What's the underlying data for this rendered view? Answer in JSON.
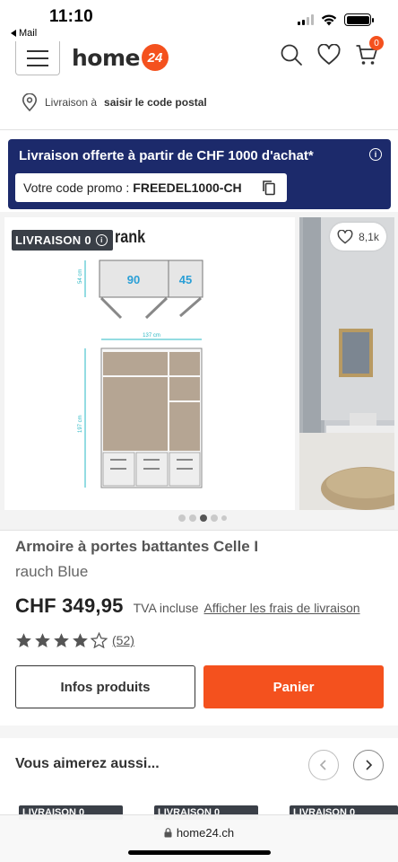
{
  "status": {
    "time": "11:10",
    "back_app": "Mail"
  },
  "header": {
    "logo_word": "home",
    "logo_badge": "24",
    "cart_count": "0"
  },
  "delivery": {
    "prefix": "Livraison à",
    "link": "saisir le code postal"
  },
  "promo": {
    "headline": "Livraison offerte à partir de CHF 1000 d'achat*",
    "code_label": "Votre code promo :",
    "code": "FREEDEL1000-CH",
    "info_glyph": "i"
  },
  "gallery": {
    "tag": "LIVRAISON 0",
    "brand_fragment": "rank",
    "wishlist_count": "8,1k",
    "dimensions": {
      "box1": "90",
      "box2": "45",
      "width": "137 cm",
      "upper_height": "54 cm",
      "lower_height": "197 cm"
    },
    "slide_count": 5,
    "active_slide": 3
  },
  "product": {
    "title": "Armoire à portes battantes Celle I",
    "brand": "rauch Blue",
    "price": "CHF 349,95",
    "tva": "TVA incluse",
    "shipping_link": "Afficher les frais de livraison",
    "rating": 4,
    "rating_max": 5,
    "reviews": "(52)"
  },
  "actions": {
    "info": "Infos produits",
    "cart": "Panier"
  },
  "recommendations": {
    "title": "Vous aimerez aussi...",
    "tag": "LIVRAISON 0"
  },
  "browser": {
    "url": "home24.ch"
  },
  "colors": {
    "brand_orange": "#f4511e",
    "promo_navy": "#1c2a6b",
    "tag_gray": "#3a3f47"
  },
  "icons": [
    "menu-icon",
    "search-icon",
    "heart-icon",
    "cart-icon",
    "location-pin-icon",
    "info-icon",
    "copy-icon",
    "star-icon",
    "chevron-left-icon",
    "chevron-right-icon",
    "lock-icon"
  ]
}
